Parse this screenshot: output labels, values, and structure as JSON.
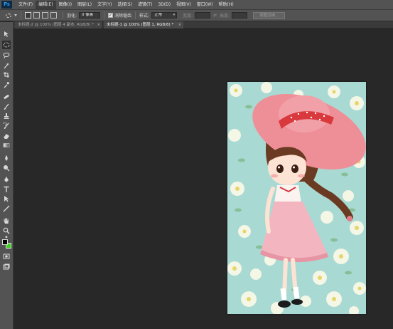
{
  "app": {
    "logo": "Ps"
  },
  "menu": [
    "文件(F)",
    "编辑(E)",
    "图像(I)",
    "图层(L)",
    "文字(Y)",
    "选择(S)",
    "滤镜(T)",
    "3D(D)",
    "视图(V)",
    "窗口(W)",
    "帮助(H)"
  ],
  "options": {
    "feather_label": "羽化:",
    "feather_value": "0 像素",
    "antialias_label": "消除锯齿",
    "style_label": "样式:",
    "style_value": "正常",
    "width_label": "宽度:",
    "height_label": "高度:",
    "refine_button": "调整边缘..."
  },
  "tabs": [
    {
      "label": "未标题-2 @ 100% (图层 4 副本, RGB/8) *",
      "active": false
    },
    {
      "label": "未标题-1 @ 100% (图层 1, RGB/8) *",
      "active": true
    }
  ],
  "tools": [
    "move-tool-icon",
    "marquee-tool-icon",
    "lasso-tool-icon",
    "magic-wand-icon",
    "crop-tool-icon",
    "eyedropper-icon",
    "healing-brush-icon",
    "brush-tool-icon",
    "clone-stamp-icon",
    "history-brush-icon",
    "eraser-icon",
    "gradient-tool-icon",
    "blur-tool-icon",
    "dodge-tool-icon",
    "pen-tool-icon",
    "type-tool-icon",
    "path-select-icon",
    "shape-tool-icon",
    "hand-tool-icon",
    "zoom-tool-icon"
  ],
  "colors": {
    "foreground": "#000000",
    "background": "#37d21a",
    "accent": "#31a8ff"
  }
}
